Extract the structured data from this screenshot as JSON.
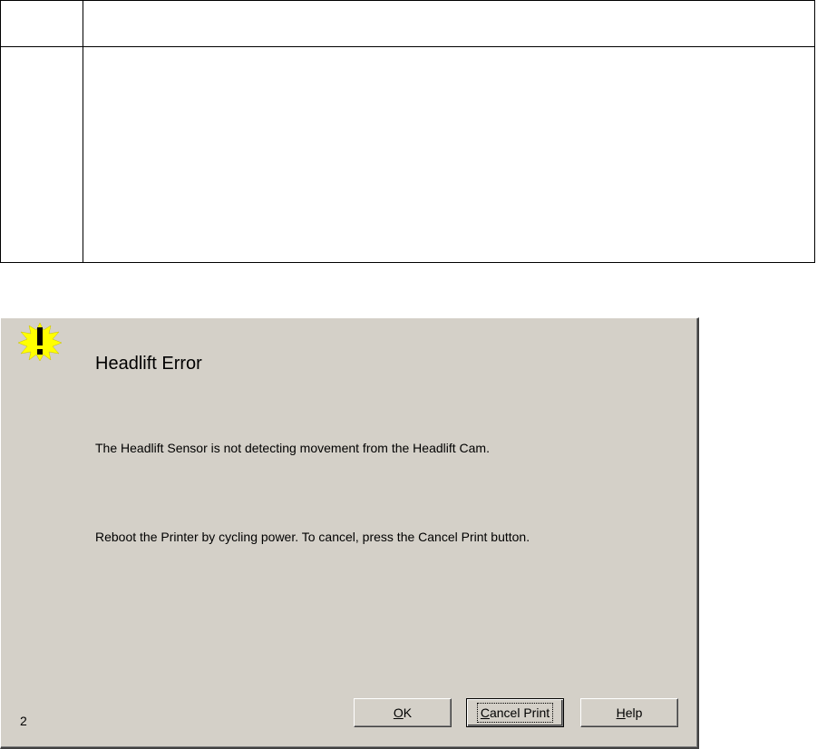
{
  "dialog": {
    "title": "Headlift Error",
    "message_line1": "The Headlift Sensor is not detecting movement from the Headlift Cam.",
    "message_line2": "Reboot the Printer by cycling power. To cancel, press the Cancel Print button.",
    "error_code": "2",
    "icon": "warning-exclamation-icon",
    "buttons": {
      "ok": {
        "mnemonic": "O",
        "rest": "K"
      },
      "cancel_print": {
        "mnemonic": "C",
        "rest": "ancel Print"
      },
      "help": {
        "mnemonic": "H",
        "rest": "elp"
      }
    }
  },
  "colors": {
    "dialog_background": "#d4d0c8",
    "icon_yellow": "#ffff00"
  }
}
